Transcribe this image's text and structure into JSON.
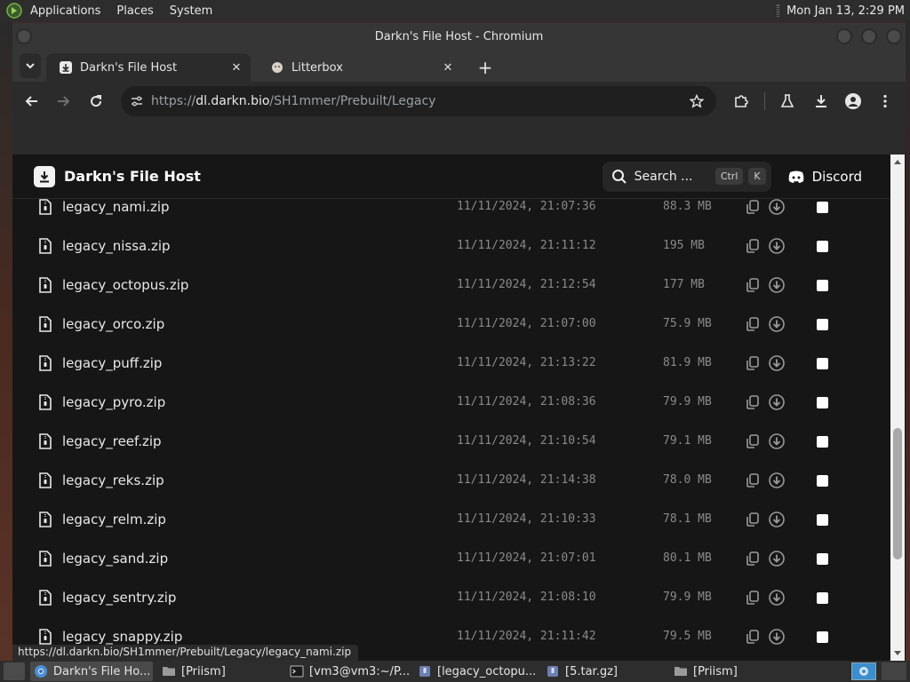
{
  "desktop": {
    "menus": [
      "Applications",
      "Places",
      "System"
    ],
    "clock": "Mon Jan 13,  2:29 PM"
  },
  "window": {
    "title": "Darkn's File Host - Chromium"
  },
  "browser": {
    "tabs": [
      {
        "title": "Darkn's File Host",
        "active": true
      },
      {
        "title": "Litterbox",
        "active": false
      }
    ],
    "url": {
      "scheme": "https://",
      "host": "dl.darkn.bio",
      "path": "/SH1mmer/Prebuilt/Legacy"
    },
    "status_url": "https://dl.darkn.bio/SH1mmer/Prebuilt/Legacy/legacy_nami.zip"
  },
  "site": {
    "name": "Darkn's File Host",
    "search_label": "Search ...",
    "search_keys": [
      "Ctrl",
      "K"
    ],
    "discord_label": "Discord"
  },
  "files": [
    {
      "name": "legacy_nami.zip",
      "date": "11/11/2024, 21:07:36",
      "size": "88.3 MB"
    },
    {
      "name": "legacy_nissa.zip",
      "date": "11/11/2024, 21:11:12",
      "size": "195 MB"
    },
    {
      "name": "legacy_octopus.zip",
      "date": "11/11/2024, 21:12:54",
      "size": "177 MB"
    },
    {
      "name": "legacy_orco.zip",
      "date": "11/11/2024, 21:07:00",
      "size": "75.9 MB"
    },
    {
      "name": "legacy_puff.zip",
      "date": "11/11/2024, 21:13:22",
      "size": "81.9 MB"
    },
    {
      "name": "legacy_pyro.zip",
      "date": "11/11/2024, 21:08:36",
      "size": "79.9 MB"
    },
    {
      "name": "legacy_reef.zip",
      "date": "11/11/2024, 21:10:54",
      "size": "79.1 MB"
    },
    {
      "name": "legacy_reks.zip",
      "date": "11/11/2024, 21:14:38",
      "size": "78.0 MB"
    },
    {
      "name": "legacy_relm.zip",
      "date": "11/11/2024, 21:10:33",
      "size": "78.1 MB"
    },
    {
      "name": "legacy_sand.zip",
      "date": "11/11/2024, 21:07:01",
      "size": "80.1 MB"
    },
    {
      "name": "legacy_sentry.zip",
      "date": "11/11/2024, 21:08:10",
      "size": "79.9 MB"
    },
    {
      "name": "legacy_snappy.zip",
      "date": "11/11/2024, 21:11:42",
      "size": "79.5 MB"
    }
  ],
  "taskbar": {
    "tasks": [
      {
        "label": "Darkn's File Ho...",
        "icon": "chromium-icon",
        "active": true
      },
      {
        "label": "[Priism]",
        "icon": "folder-icon",
        "active": false
      },
      {
        "label": "[vm3@vm3:~/P...",
        "icon": "terminal-icon",
        "active": false
      },
      {
        "label": "[legacy_octopu...",
        "icon": "archive-icon",
        "active": false
      },
      {
        "label": "[5.tar.gz]",
        "icon": "archive-icon",
        "active": false
      },
      {
        "label": "[Priism]",
        "icon": "folder-icon",
        "active": false
      }
    ]
  },
  "colors": {
    "page_bg": "#161616",
    "text_primary": "#e8e8e8",
    "text_muted": "#8a8a8a",
    "browser_chrome": "#2b2b2b",
    "workspace_active": "#3c8ecc"
  }
}
